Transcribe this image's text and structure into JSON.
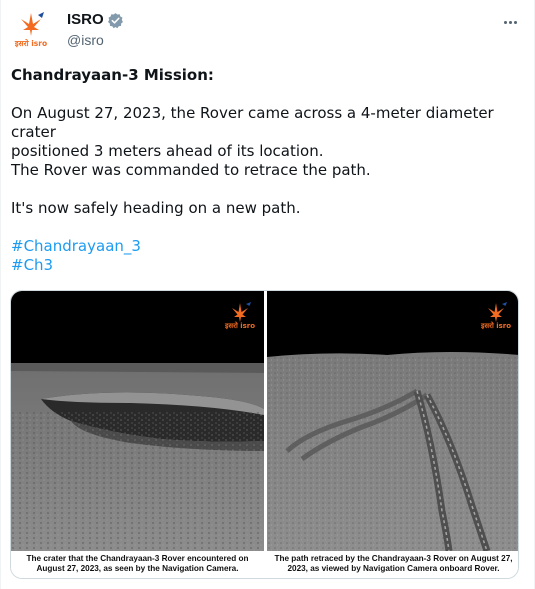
{
  "author": {
    "name": "ISRO",
    "handle": "@isro",
    "avatar_logo_text": "इसरो isro"
  },
  "tweet": {
    "heading": "Chandrayaan-3 Mission:",
    "line1": "On August 27, 2023, the Rover came across a 4-meter diameter crater",
    "line2": "positioned 3 meters ahead of its location.",
    "line3": "The Rover was commanded to retrace the path.",
    "line4": "It's now safely heading on a new path.",
    "hashtag1": "#Chandrayaan_3",
    "hashtag2": "#Ch3"
  },
  "media": {
    "left": {
      "logo_text": "इसरो isro",
      "caption_line1": "The crater that the Chandrayaan-3 Rover encountered on",
      "caption_line2": "August 27, 2023, as seen by the Navigation Camera."
    },
    "right": {
      "logo_text": "इसरो isro",
      "caption_line1": "The path retraced by the Chandrayaan-3 Rover on August 27,",
      "caption_line2": "2023, as viewed by Navigation Camera onboard Rover."
    }
  },
  "colors": {
    "hashtag": "#1d9bf0",
    "verified": "#829aab",
    "isro_orange": "#f26b21",
    "isro_blue": "#1f4e9c"
  }
}
